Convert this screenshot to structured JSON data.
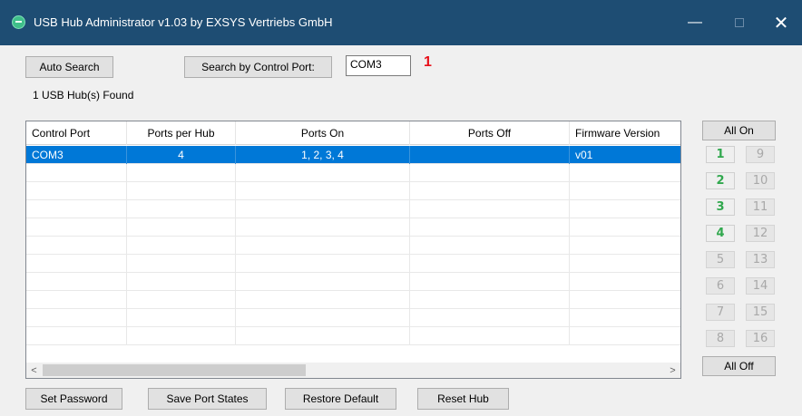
{
  "window": {
    "title": "USB Hub Administrator v1.03 by EXSYS Vertriebs GmbH",
    "minimize_glyph": "—",
    "close_glyph": "✕"
  },
  "toolbar": {
    "auto_search_label": "Auto Search",
    "search_by_port_label": "Search by Control Port:",
    "control_port_value": "COM3",
    "annotation": "1"
  },
  "status": {
    "found_text": "1 USB Hub(s) Found"
  },
  "table": {
    "columns": [
      "Control Port",
      "Ports per Hub",
      "Ports On",
      "Ports Off",
      "Firmware Version"
    ],
    "rows": [
      {
        "control_port": "COM3",
        "ports_per_hub": "4",
        "ports_on": "1, 2, 3, 4",
        "ports_off": "",
        "firmware_version": "v01",
        "selected": true
      }
    ],
    "scroll_left_glyph": "<",
    "scroll_right_glyph": ">"
  },
  "ports": {
    "all_on_label": "All On",
    "all_off_label": "All Off",
    "left_column": [
      {
        "label": "1",
        "active": true
      },
      {
        "label": "2",
        "active": true
      },
      {
        "label": "3",
        "active": true
      },
      {
        "label": "4",
        "active": true
      },
      {
        "label": "5",
        "active": false
      },
      {
        "label": "6",
        "active": false
      },
      {
        "label": "7",
        "active": false
      },
      {
        "label": "8",
        "active": false
      }
    ],
    "right_column": [
      {
        "label": "9",
        "active": false
      },
      {
        "label": "10",
        "active": false
      },
      {
        "label": "11",
        "active": false
      },
      {
        "label": "12",
        "active": false
      },
      {
        "label": "13",
        "active": false
      },
      {
        "label": "14",
        "active": false
      },
      {
        "label": "15",
        "active": false
      },
      {
        "label": "16",
        "active": false
      }
    ]
  },
  "footer": {
    "set_password_label": "Set Password",
    "save_port_states_label": "Save Port States",
    "restore_default_label": "Restore Default",
    "reset_hub_label": "Reset Hub"
  },
  "colors": {
    "titlebar": "#1e4d73",
    "selection": "#0078d7",
    "port_active_text": "#31a84e",
    "annotation_red": "#e8101a"
  }
}
